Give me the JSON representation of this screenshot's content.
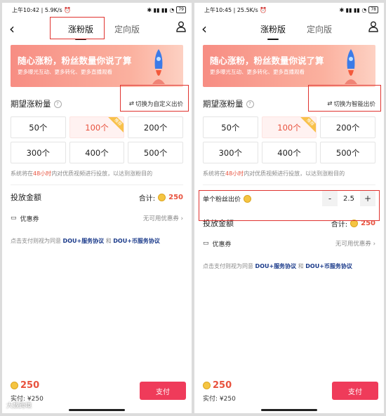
{
  "left": {
    "status": {
      "time": "上午10:42",
      "speed": "5.9K/s",
      "battery": "79"
    },
    "tabs": [
      "涨粉版",
      "定向版"
    ],
    "banner": {
      "title": "随心涨粉，粉丝数量你说了算",
      "subtitle": "更多曝光互动、更多转化、更多直播观看"
    },
    "section_title": "期望涨粉量",
    "switch_label": "切换为自定义出价",
    "options": [
      "50个",
      "100个",
      "200个",
      "300个",
      "400个",
      "500个"
    ],
    "recommend_badge": "推荐",
    "hint": {
      "pre": "系统将在",
      "hours": "48小时",
      "post": "内对优质视频进行投放，以达到涨粉目的"
    },
    "amount_title": "投放金额",
    "total_label": "合计:",
    "total_value": "250",
    "coupon_label": "优惠券",
    "coupon_status": "无可用优惠券",
    "agree": {
      "pre": "点击支付则视为同意",
      "link1": "DOU+服务协议",
      "and": "和",
      "link2": "DOU+币服务协议"
    },
    "bottom_amount": "250",
    "real_pay": "实付: ¥250",
    "pay_label": "支付"
  },
  "right": {
    "status": {
      "time": "上午10:45",
      "speed": "25.5K/s",
      "battery": "78"
    },
    "tabs": [
      "涨粉版",
      "定向版"
    ],
    "banner": {
      "title": "随心涨粉，粉丝数量你说了算",
      "subtitle": "更多曝光互动、更多转化、更多直播观看"
    },
    "section_title": "期望涨粉量",
    "switch_label": "切换为智能出价",
    "options": [
      "50个",
      "100个",
      "200个",
      "300个",
      "400个",
      "500个"
    ],
    "recommend_badge": "推荐",
    "hint": {
      "pre": "系统将在",
      "hours": "48小时",
      "post": "内对优质视频进行投放，以达到涨粉目的"
    },
    "bid_label": "单个粉丝出价",
    "bid_minus": "-",
    "bid_value": "2.5",
    "bid_plus": "+",
    "amount_title": "投放金额",
    "total_label": "合计:",
    "total_value": "250",
    "coupon_label": "优惠券",
    "coupon_status": "无可用优惠券",
    "agree": {
      "pre": "点击支付则视为同意",
      "link1": "DOU+服务协议",
      "and": "和",
      "link2": "DOU+币服务协议"
    },
    "bottom_amount": "250",
    "real_pay": "实付: ¥250",
    "pay_label": "支付"
  },
  "watermark": "大数跨境",
  "colors": {
    "accent": "#ef3b5a",
    "highlight": "#e0332f",
    "price": "#e8523e",
    "link": "#1a3a8a",
    "coin": "#f5c542"
  }
}
